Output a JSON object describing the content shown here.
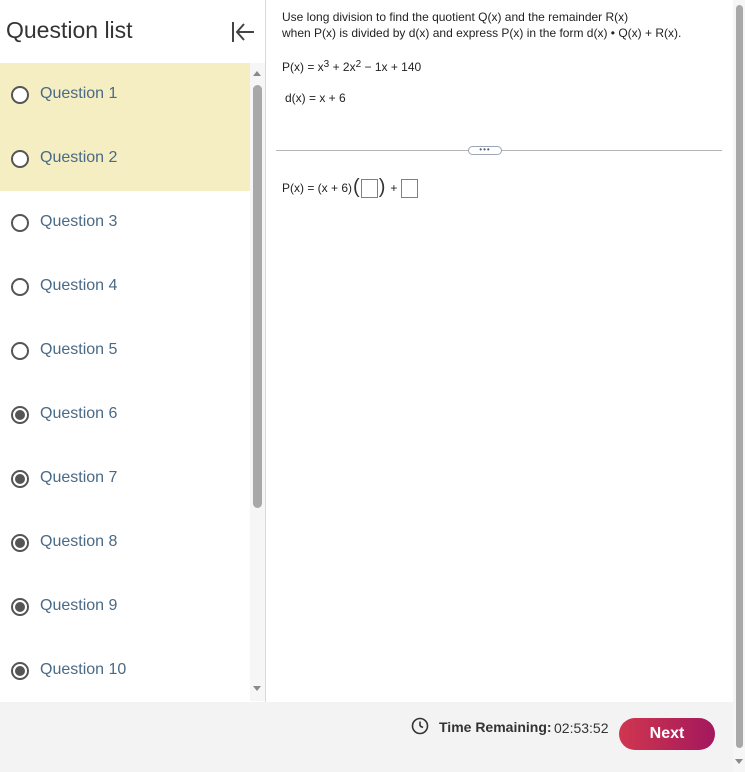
{
  "sidebar": {
    "title": "Question list",
    "questions": [
      {
        "label": "Question 1",
        "answered": false,
        "current": true
      },
      {
        "label": "Question 2",
        "answered": false,
        "current": true
      },
      {
        "label": "Question 3",
        "answered": false,
        "current": false
      },
      {
        "label": "Question 4",
        "answered": false,
        "current": false
      },
      {
        "label": "Question 5",
        "answered": false,
        "current": false
      },
      {
        "label": "Question 6",
        "answered": true,
        "current": false
      },
      {
        "label": "Question 7",
        "answered": true,
        "current": false
      },
      {
        "label": "Question 8",
        "answered": true,
        "current": false
      },
      {
        "label": "Question 9",
        "answered": true,
        "current": false
      },
      {
        "label": "Question 10",
        "answered": true,
        "current": false
      }
    ]
  },
  "question": {
    "instruction_line1": "Use long division to find the quotient Q(x) and the remainder R(x)",
    "instruction_line2": "when P(x) is divided by d(x) and express P(x) in the form d(x) • Q(x) + R(x).",
    "p_lhs": "P(x) = x",
    "p_exp1": "3",
    "p_mid": " + 2x",
    "p_exp2": "2",
    "p_rest": " − 1x + 140",
    "d_eq": "d(x) = x + 6",
    "expand_label": "•••",
    "answer_prefix": "P(x) = (x + 6)",
    "answer_plus": "+"
  },
  "footer": {
    "time_label": "Time Remaining:",
    "time_value": "02:53:52",
    "next_label": "Next"
  },
  "colors": {
    "current_highlight": "#f5eec3",
    "question_link": "#4a6a85",
    "next_gradient_start": "#d0364f",
    "next_gradient_end": "#a3185d",
    "answer_box_border": "#5a86c7"
  }
}
